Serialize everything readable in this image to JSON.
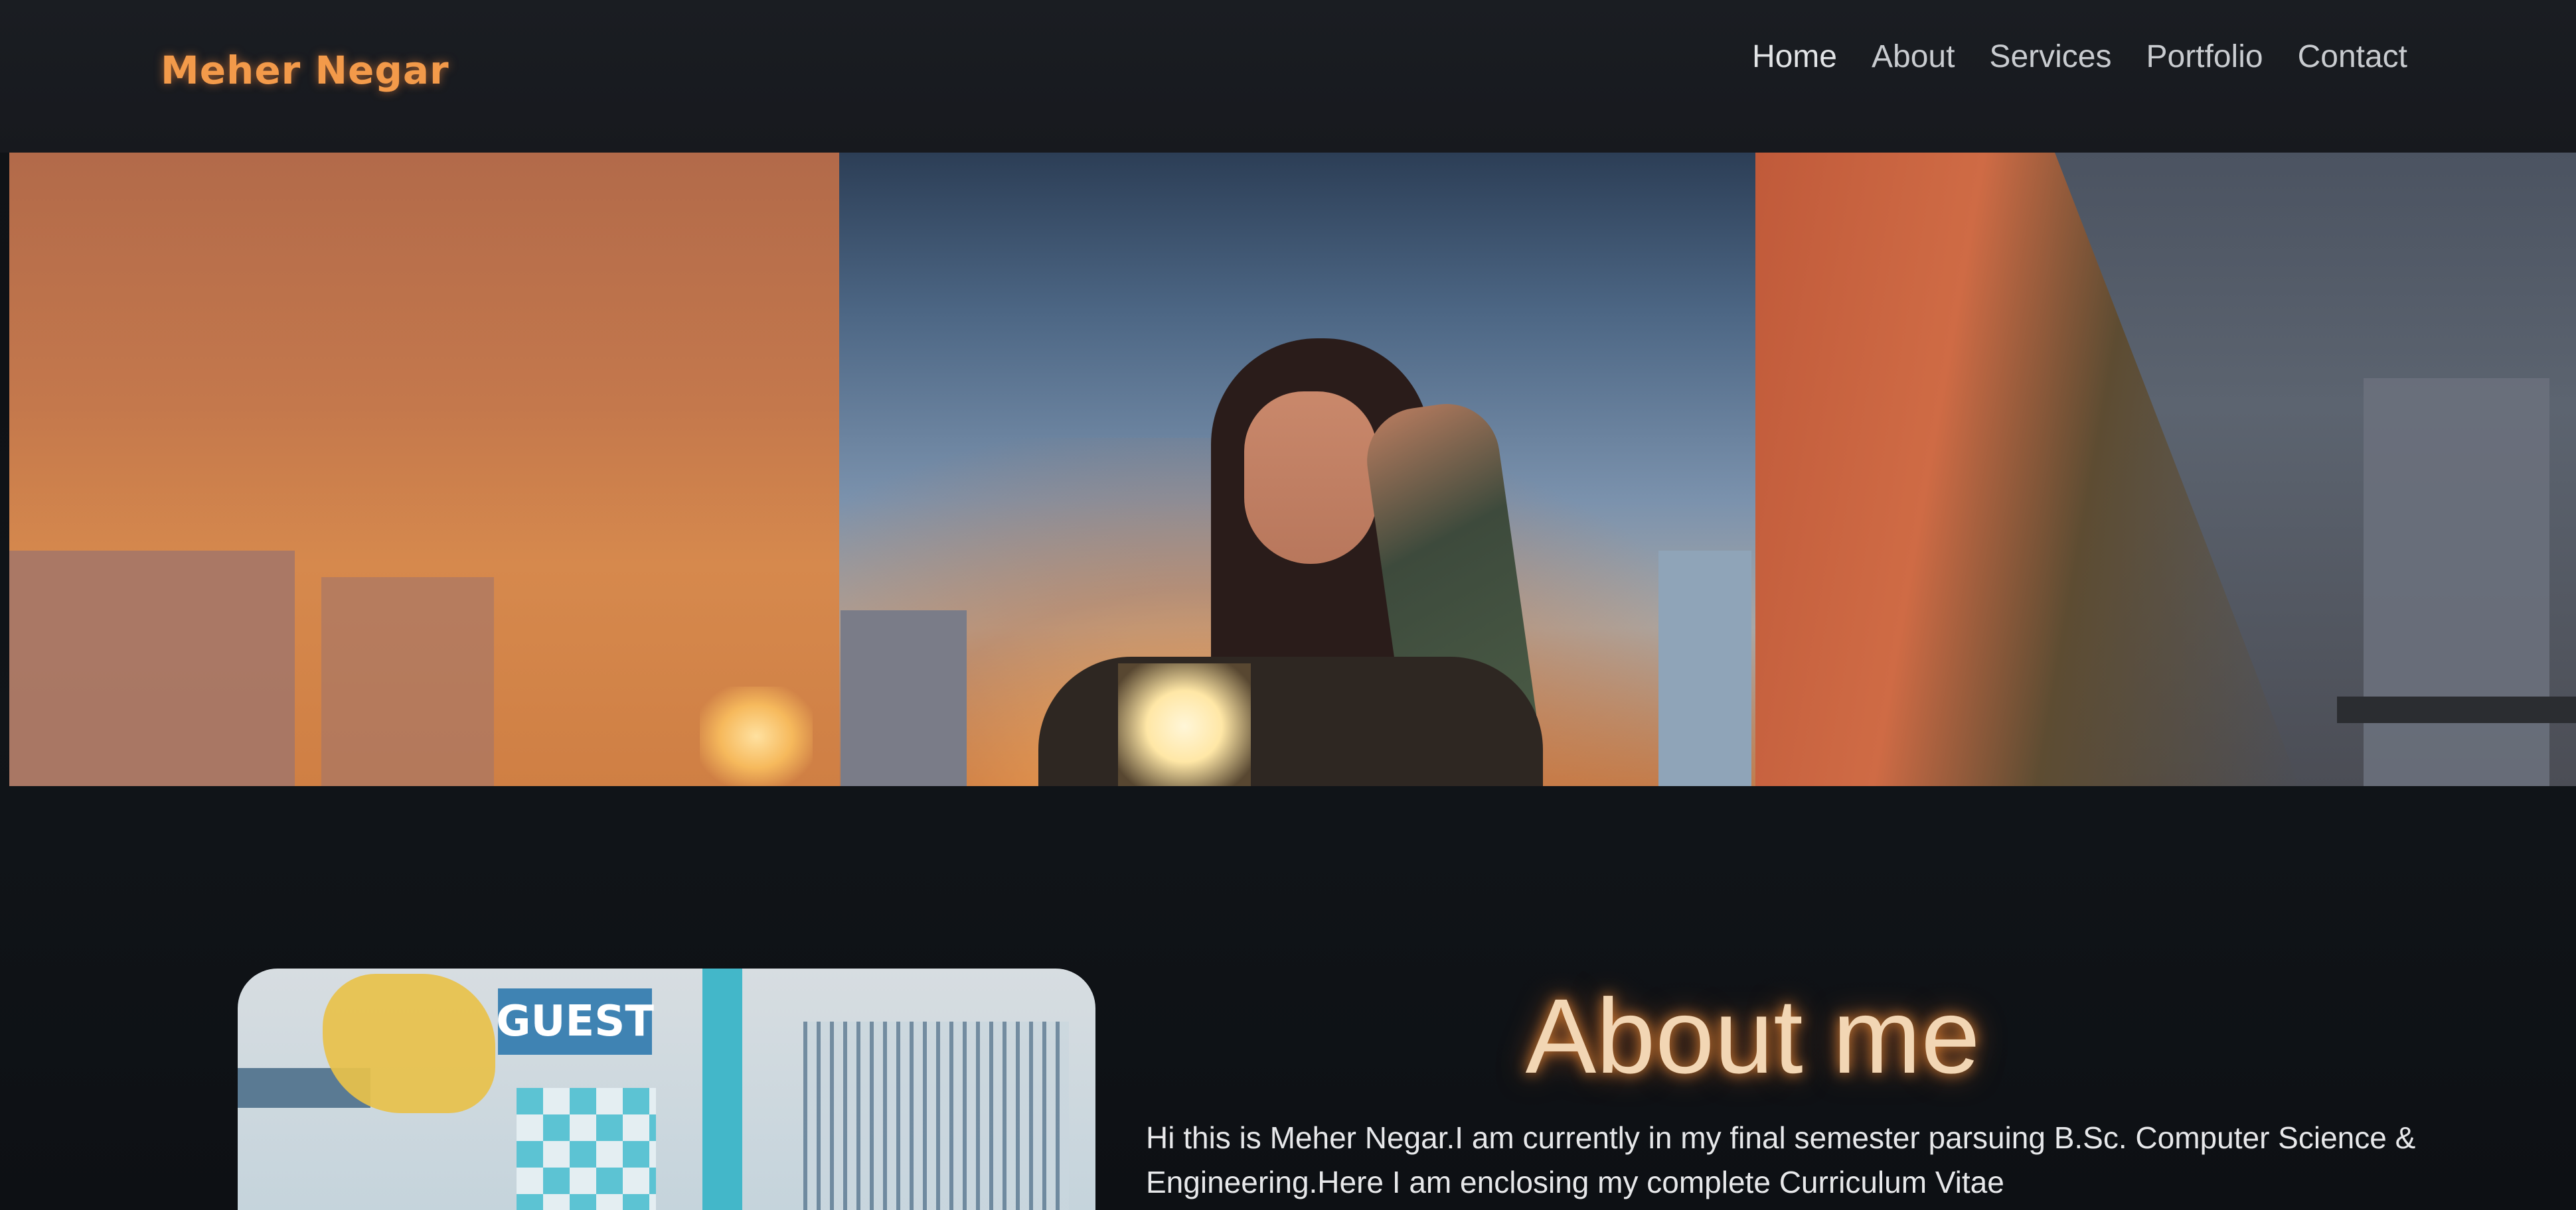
{
  "brand": {
    "name": "Meher Negar"
  },
  "nav": {
    "items": [
      {
        "label": "Home"
      },
      {
        "label": "About"
      },
      {
        "label": "Services"
      },
      {
        "label": "Portfolio"
      },
      {
        "label": "Contact"
      }
    ]
  },
  "hero": {
    "panels": [
      "left-city-glow",
      "center-portrait",
      "right-arm-closeup"
    ]
  },
  "about": {
    "title": "About me",
    "photo_sign": "GUEST",
    "text": "Hi this is Meher Negar.I am currently in my final semester parsuing B.Sc. Computer Science & Engineering.Here I am enclosing my complete Curriculum Vitae"
  },
  "colors": {
    "brand": "#f39a4a",
    "nav_text": "#c9ccd0",
    "background": "#0f1216",
    "title_glow": "#ff9640"
  }
}
